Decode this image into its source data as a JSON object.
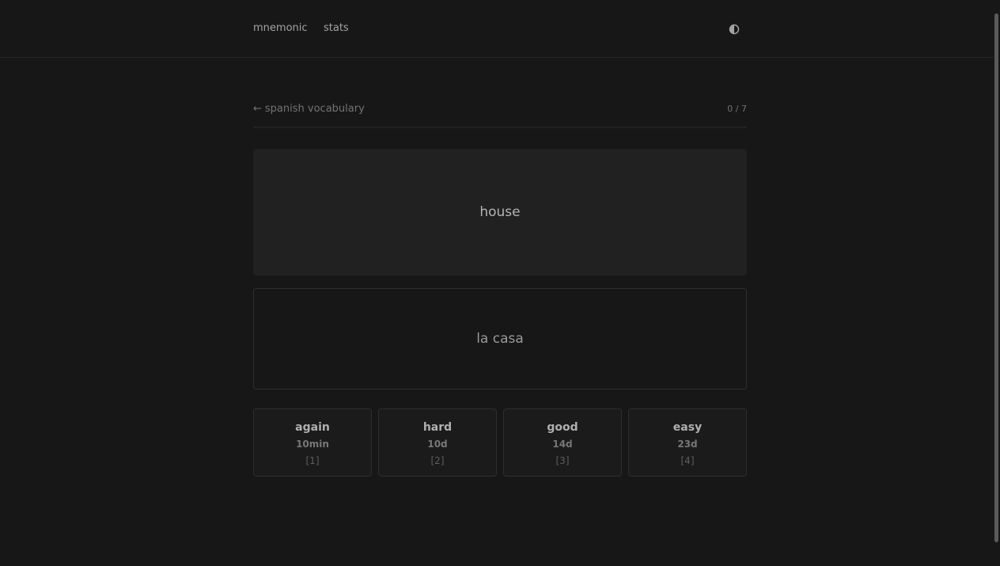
{
  "nav": {
    "brand": "mnemonic",
    "stats_link": "stats",
    "theme_toggle_icon": "half-circle-contrast-icon"
  },
  "deck": {
    "back_arrow": "←",
    "back_label": "spanish vocabulary",
    "progress_text": "0 / 7",
    "progress_fraction": 0
  },
  "card": {
    "front": "house",
    "back": "la casa"
  },
  "ratings": [
    {
      "label": "again",
      "interval": "10min",
      "key": "[1]"
    },
    {
      "label": "hard",
      "interval": "10d",
      "key": "[2]"
    },
    {
      "label": "good",
      "interval": "14d",
      "key": "[3]"
    },
    {
      "label": "easy",
      "interval": "23d",
      "key": "[4]"
    }
  ],
  "colors": {
    "background": "#171717",
    "card_front_bg": "#212121",
    "border": "#2e2e2e",
    "text_primary": "#b5b5b5",
    "text_muted": "#737373"
  }
}
